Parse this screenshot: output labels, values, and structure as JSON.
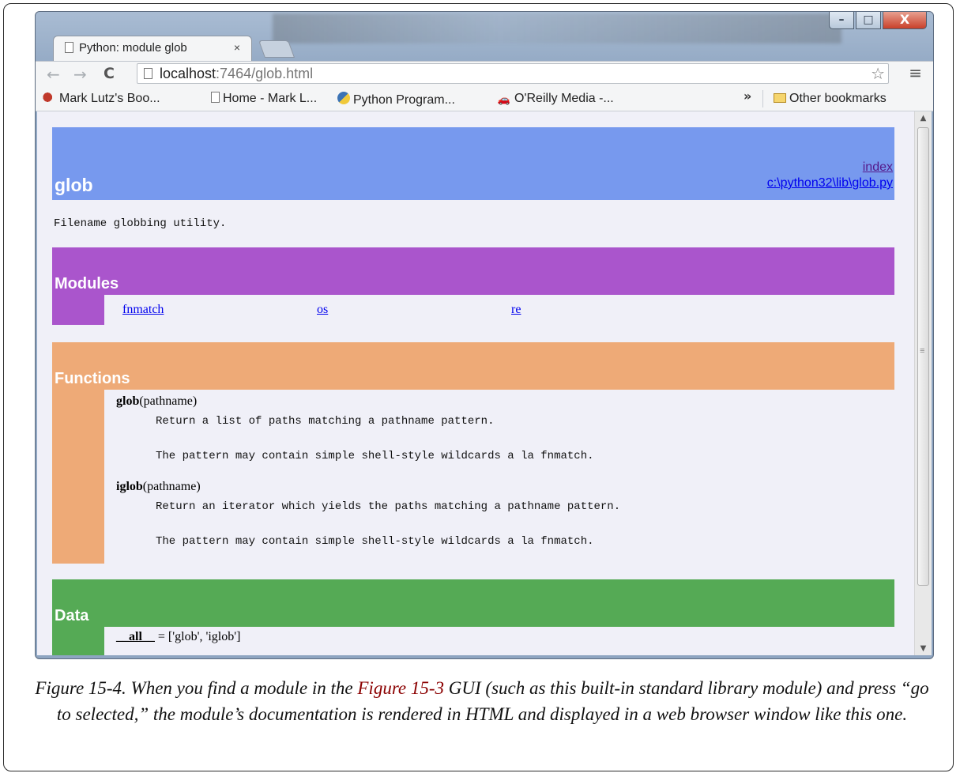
{
  "browser": {
    "tab_title": "Python: module glob",
    "tab_close": "×",
    "url_host": "localhost",
    "url_rest": ":7464/glob.html",
    "nav": {
      "back": "←",
      "forward": "→",
      "reload": "C"
    },
    "star": "☆",
    "menu": "≡",
    "window_buttons": {
      "minimize": "–",
      "maximize": "□",
      "close": "X"
    }
  },
  "bookmarks": {
    "items": [
      {
        "label": "Mark Lutz's Boo...",
        "icon": "oreilly-logo-icon"
      },
      {
        "label": "Home - Mark L...",
        "icon": "document-icon"
      },
      {
        "label": "Python Program...",
        "icon": "python-icon"
      },
      {
        "label": "O'Reilly Media -...",
        "icon": "car-icon"
      }
    ],
    "overflow": "»",
    "other": "Other bookmarks"
  },
  "page": {
    "module_name": "glob",
    "index_link": "index",
    "file_link": "c:\\python32\\lib\\glob.py",
    "description": "Filename globbing utility.",
    "modules_heading": "Modules",
    "modules": [
      "fnmatch",
      "os",
      "re"
    ],
    "functions_heading": "Functions",
    "functions": [
      {
        "name": "glob",
        "args": "(pathname)",
        "doc1": "Return a list of paths matching a pathname pattern.",
        "doc2": "The pattern may contain simple shell-style wildcards a la fnmatch."
      },
      {
        "name": "iglob",
        "args": "(pathname)",
        "doc1": "Return an iterator which yields the paths matching a pathname pattern.",
        "doc2": "The pattern may contain simple shell-style wildcards a la fnmatch."
      }
    ],
    "data_heading": "Data",
    "data_item_name": "__all__",
    "data_item_value": " = ['glob', 'iglob']"
  },
  "caption": {
    "part1": "Figure 15-4. When you find a module in the ",
    "ref": "Figure 15-3",
    "part2": " GUI (such as this built-in standard library module) and press “go to selected,” the module’s documentation is rendered in HTML and displayed in a web browser window like this one."
  },
  "colors": {
    "heading": "#7799ee",
    "modules": "#aa55cc",
    "functions": "#eeaa77",
    "data": "#55aa55"
  }
}
